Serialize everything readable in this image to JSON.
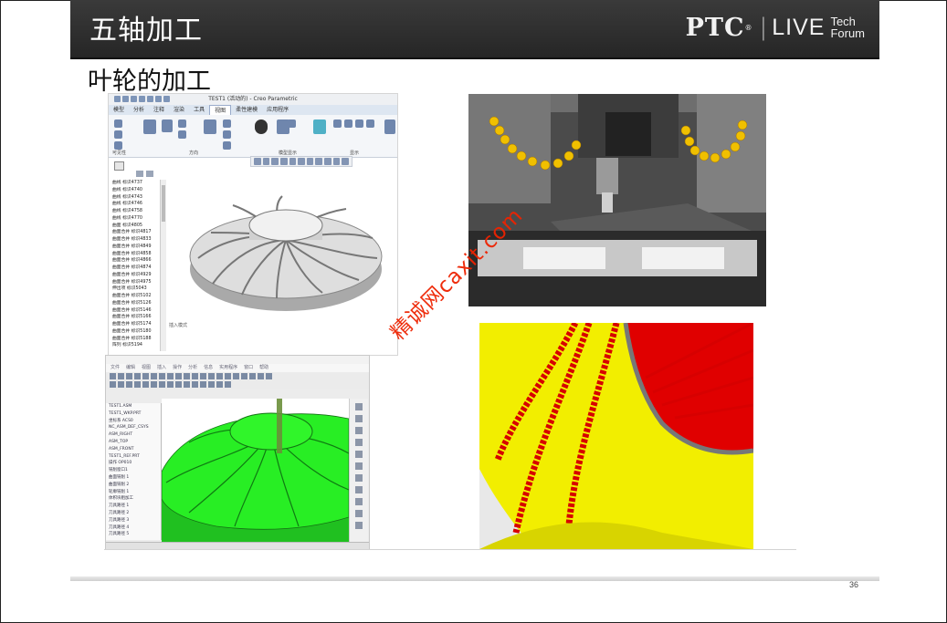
{
  "header": {
    "title": "五轴加工"
  },
  "logo": {
    "brand": "PTC",
    "reg": "®",
    "separator": "|",
    "event": "LIVE",
    "line1": "Tech",
    "line2": "Forum"
  },
  "slide": {
    "subtitle": "叶轮的加工",
    "page_number": "36"
  },
  "watermark": "精诚网caxit.com",
  "creo_window": {
    "title": "TEST1 (活动的) - Creo Parametric",
    "tabs": [
      "模型",
      "分析",
      "注释",
      "渲染",
      "工具",
      "视图",
      "柔性建模",
      "应用程序"
    ],
    "active_tab": "视图",
    "ribbon_labels": [
      "可见性",
      "方向",
      "模型显示",
      "显示"
    ],
    "tree_items": [
      "曲线 标识4737",
      "曲线 标识4740",
      "曲线 标识4743",
      "曲线 标识4746",
      "曲线 标识4758",
      "曲线 标识4770",
      "曲面 标识4805",
      "曲面合并 标识4817",
      "曲面合并 标识4833",
      "曲面合并 标识4849",
      "曲面合并 标识4858",
      "曲面合并 标识4866",
      "曲面合并 标识4874",
      "曲面合并 标识4929",
      "曲面合并 标识4975",
      "伸出项 标识5043",
      "曲面合并 标识5102",
      "曲面合并 标识5126",
      "曲面合并 标识5146",
      "曲面合并 标识5166",
      "曲面合并 标识5174",
      "曲面合并 标识5180",
      "曲面合并 标识5188",
      "阵列 标识5194"
    ],
    "status": "插入模式"
  },
  "sim_window": {
    "menu": [
      "文件",
      "编辑",
      "视图",
      "插入",
      "操作",
      "分析",
      "信息",
      "实用程序",
      "窗口",
      "帮助"
    ],
    "tree_items": [
      "TEST1.ASM",
      "TEST1_WKP.PRT",
      "坐标系 ACS0",
      "NC_ASM_DEF_CSYS",
      "ASM_RIGHT",
      "ASM_TOP",
      "ASM_FRONT",
      "TEST1_REF.PRT",
      "操作 OP010",
      "铣削窗口1",
      "曲面铣削 1",
      "曲面铣削 2",
      "轮廓铣削 1",
      "体积块粗加工",
      "刀具路径 1",
      "刀具路径 2",
      "刀具路径 3",
      "刀具路径 4",
      "刀具路径 5"
    ]
  },
  "colors": {
    "header_bg": "#2e2e2e",
    "impeller_green": "#22e81e",
    "cut_red": "#e10000",
    "part_yellow": "#f4ee00",
    "watermark_red": "#ee2200"
  }
}
